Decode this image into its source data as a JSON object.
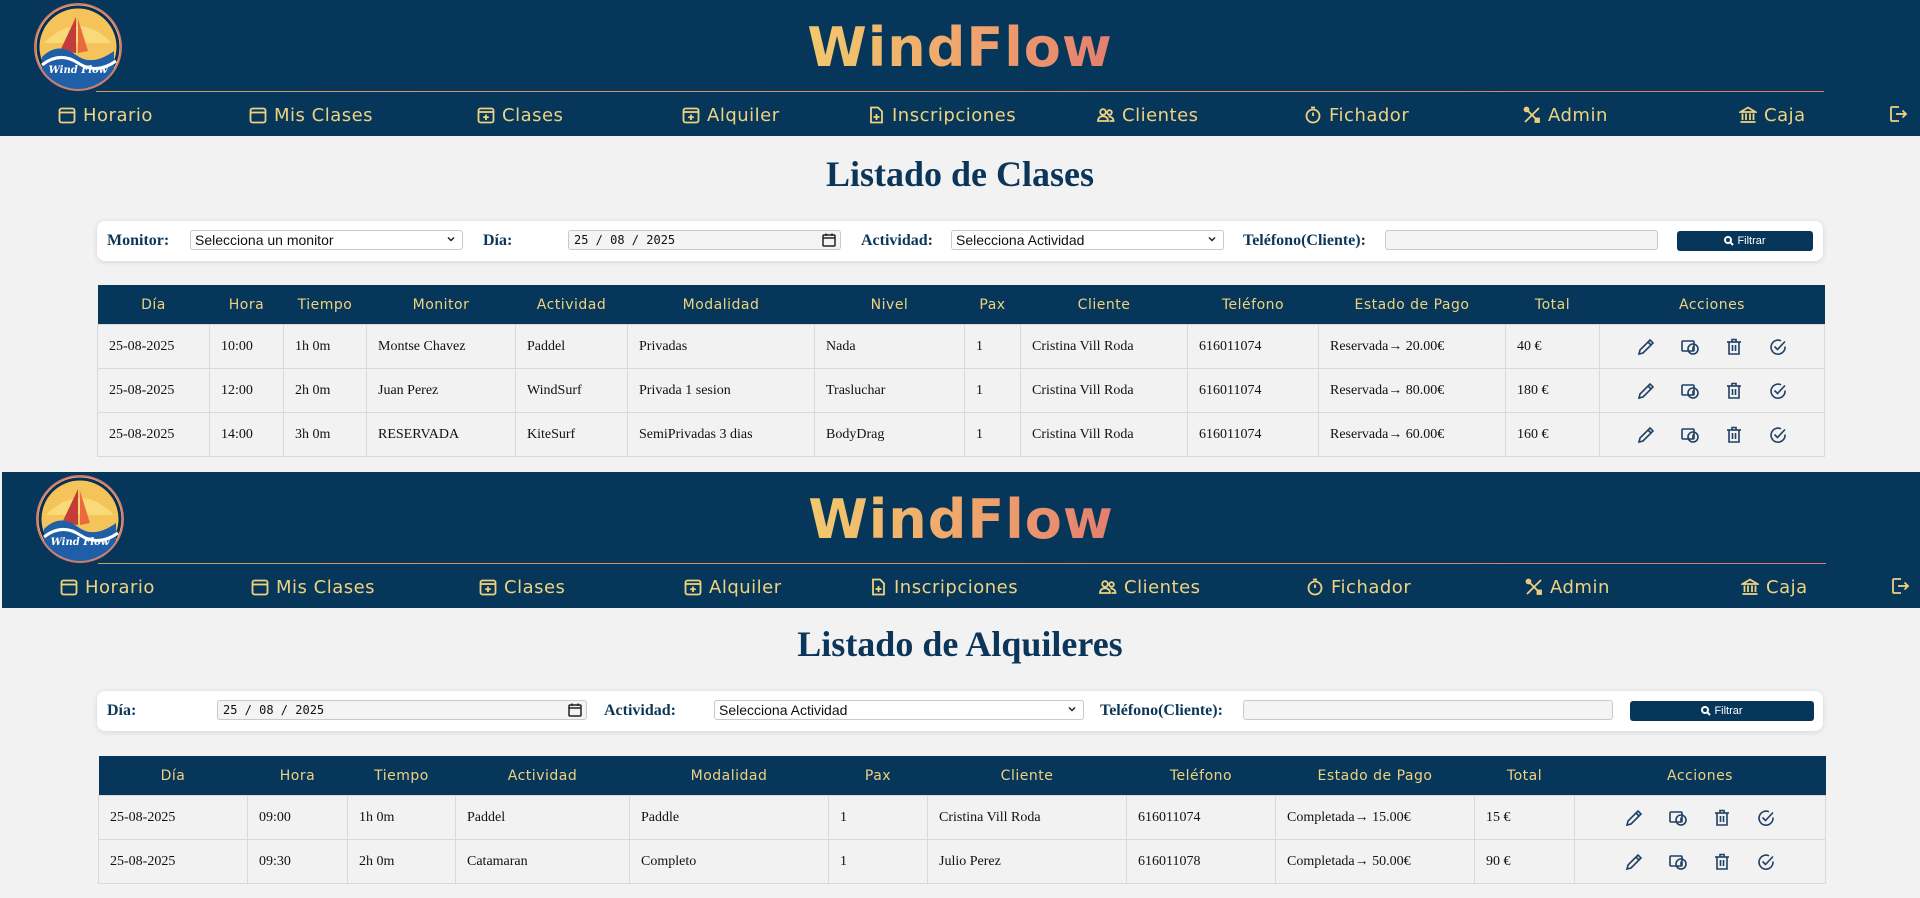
{
  "brand": "WindFlow",
  "logo_text": "Wind Flow",
  "nav": [
    {
      "label": "Horario",
      "icon": "calendar-icon"
    },
    {
      "label": "Mis Clases",
      "icon": "calendar-icon"
    },
    {
      "label": "Clases",
      "icon": "calendar-plus-icon"
    },
    {
      "label": "Alquiler",
      "icon": "calendar-plus-icon"
    },
    {
      "label": "Inscripciones",
      "icon": "file-plus-icon"
    },
    {
      "label": "Clientes",
      "icon": "people-icon"
    },
    {
      "label": "Fichador",
      "icon": "stopwatch-icon"
    },
    {
      "label": "Admin",
      "icon": "tools-icon"
    },
    {
      "label": "Caja",
      "icon": "bank-icon"
    }
  ],
  "classes_page": {
    "title": "Listado de Clases",
    "filters": {
      "monitor_label": "Monitor:",
      "monitor_value": "Selecciona un monitor",
      "day_label": "Día:",
      "day_value": "25 / 08 / 2025",
      "activity_label": "Actividad:",
      "activity_value": "Selecciona Actividad",
      "phone_label": "Teléfono(Cliente):",
      "phone_value": "",
      "filter_button": "Filtrar"
    },
    "columns": [
      "Día",
      "Hora",
      "Tiempo",
      "Monitor",
      "Actividad",
      "Modalidad",
      "Nivel",
      "Pax",
      "Cliente",
      "Teléfono",
      "Estado de Pago",
      "Total",
      "Acciones"
    ],
    "rows": [
      [
        "25-08-2025",
        "10:00",
        "1h 0m",
        "Montse Chavez",
        "Paddel",
        "Privadas",
        "Nada",
        "1",
        "Cristina Vill Roda",
        "616011074",
        "Reservada→ 20.00€",
        "40 €"
      ],
      [
        "25-08-2025",
        "12:00",
        "2h 0m",
        "Juan Perez",
        "WindSurf",
        "Privada 1 sesion",
        "Trasluchar",
        "1",
        "Cristina Vill Roda",
        "616011074",
        "Reservada→ 80.00€",
        "180 €"
      ],
      [
        "25-08-2025",
        "14:00",
        "3h 0m",
        "RESERVADA",
        "KiteSurf",
        "SemiPrivadas 3 dias",
        "BodyDrag",
        "1",
        "Cristina Vill Roda",
        "616011074",
        "Reservada→ 60.00€",
        "160 €"
      ]
    ]
  },
  "rentals_page": {
    "title": "Listado de Alquileres",
    "filters": {
      "day_label": "Día:",
      "day_value": "25 / 08 / 2025",
      "activity_label": "Actividad:",
      "activity_value": "Selecciona Actividad",
      "phone_label": "Teléfono(Cliente):",
      "phone_value": "",
      "filter_button": "Filtrar"
    },
    "columns": [
      "Día",
      "Hora",
      "Tiempo",
      "Actividad",
      "Modalidad",
      "Pax",
      "Cliente",
      "Teléfono",
      "Estado de Pago",
      "Total",
      "Acciones"
    ],
    "rows": [
      [
        "25-08-2025",
        "09:00",
        "1h 0m",
        "Paddel",
        "Paddle",
        "1",
        "Cristina Vill Roda",
        "616011074",
        "Completada→ 15.00€",
        "15 €"
      ],
      [
        "25-08-2025",
        "09:30",
        "2h 0m",
        "Catamaran",
        "Completo",
        "1",
        "Julio Perez",
        "616011078",
        "Completada→ 50.00€",
        "90 €"
      ]
    ]
  },
  "row_actions": [
    "edit-icon",
    "payment-icon",
    "trash-icon",
    "check-circle-icon"
  ],
  "colors": {
    "header_bg": "#06375a",
    "gold": "#efd27f",
    "title_blue": "#0c3659"
  }
}
